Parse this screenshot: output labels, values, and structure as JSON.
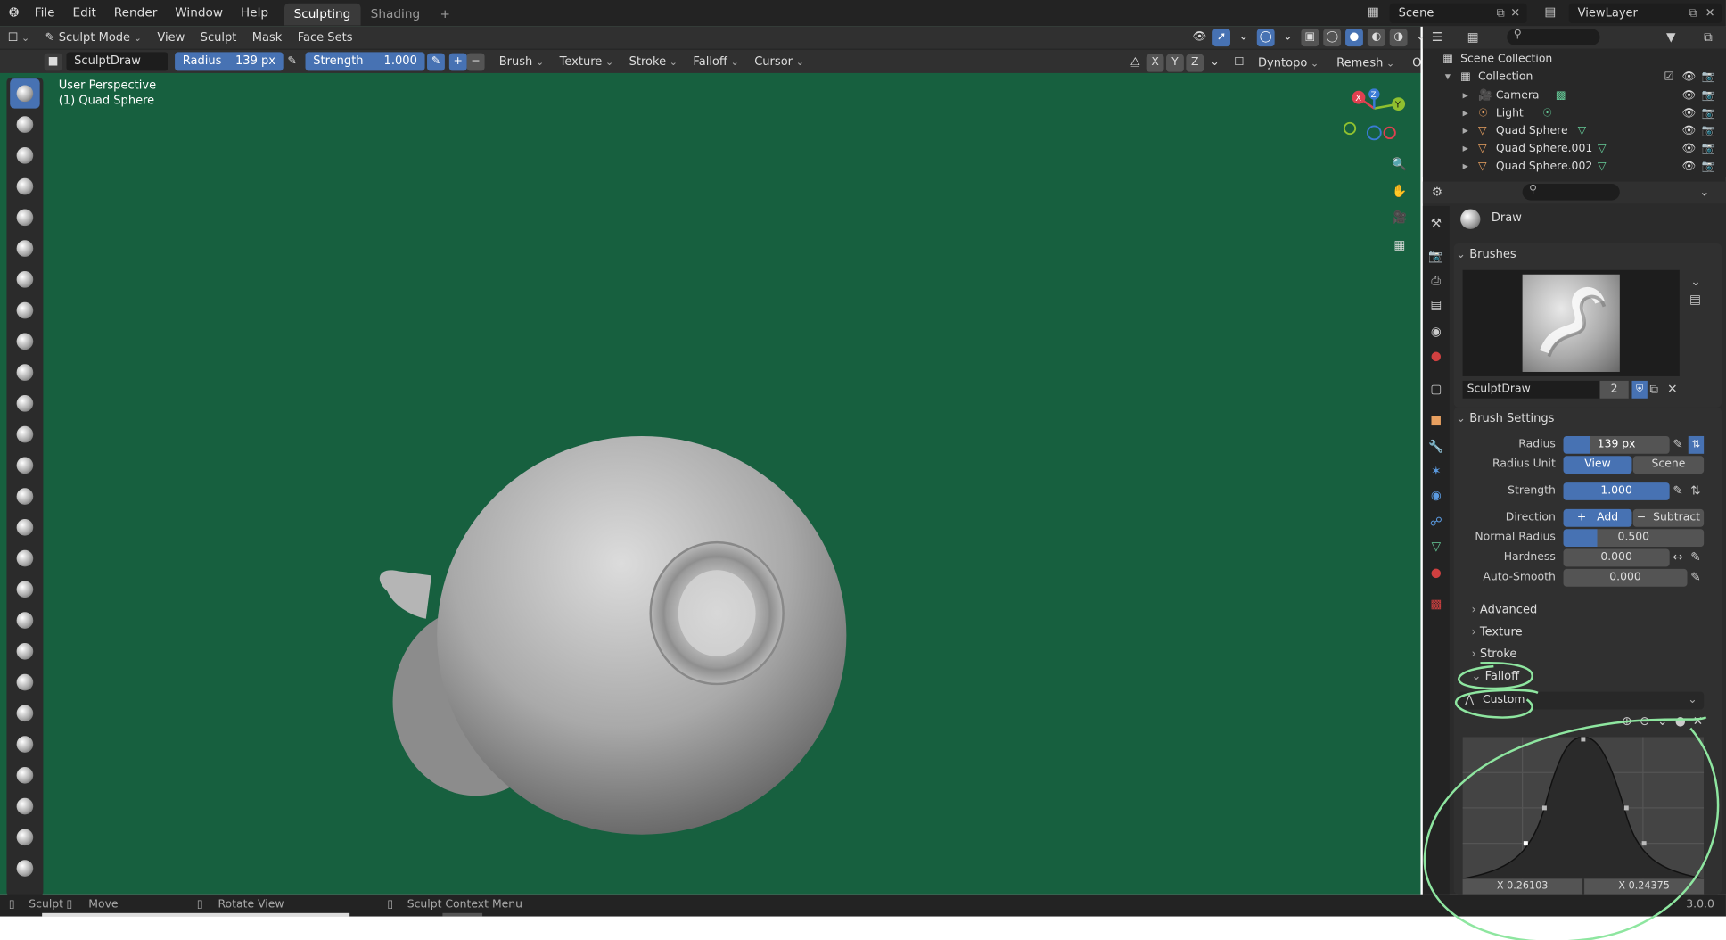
{
  "menu": {
    "items": [
      "File",
      "Edit",
      "Render",
      "Window",
      "Help"
    ],
    "workspaces": [
      "Sculpting",
      "Shading",
      "+"
    ],
    "scene": "Scene",
    "view_layer": "ViewLayer"
  },
  "viewport_header": {
    "mode": "Sculpt Mode",
    "menus": [
      "View",
      "Sculpt",
      "Mask",
      "Face Sets"
    ]
  },
  "tool_header": {
    "brush_name": "SculptDraw",
    "radius_label": "Radius",
    "radius_value": "139 px",
    "strength_label": "Strength",
    "strength_value": "1.000",
    "dropdowns": [
      "Brush",
      "Texture",
      "Stroke",
      "Falloff",
      "Cursor"
    ],
    "axes": [
      "X",
      "Y",
      "Z"
    ],
    "dyntopo": "Dyntopo",
    "remesh": "Remesh",
    "options": "Options"
  },
  "viewport": {
    "perspective": "User Perspective",
    "object": "(1) Quad Sphere",
    "bg_color": "#17603f"
  },
  "gizmo": {
    "x": "X",
    "y": "Y",
    "z": "Z"
  },
  "outliner": {
    "root": "Scene Collection",
    "collection": "Collection",
    "items": [
      "Camera",
      "Light",
      "Quad Sphere",
      "Quad Sphere.001",
      "Quad Sphere.002"
    ]
  },
  "properties": {
    "tool_name": "Draw",
    "brushes_panel": "Brushes",
    "brush_datablock": "SculptDraw",
    "brush_users": "2",
    "brush_settings_panel": "Brush Settings",
    "radius": {
      "label": "Radius",
      "value": "139 px"
    },
    "radius_unit": {
      "label": "Radius Unit",
      "options": [
        "View",
        "Scene"
      ],
      "selected": "View"
    },
    "strength": {
      "label": "Strength",
      "value": "1.000"
    },
    "direction": {
      "label": "Direction",
      "options": [
        "Add",
        "Subtract"
      ],
      "selected": "Add"
    },
    "normal_radius": {
      "label": "Normal Radius",
      "value": "0.500",
      "fraction": 0.5
    },
    "hardness": {
      "label": "Hardness",
      "value": "0.000"
    },
    "auto_smooth": {
      "label": "Auto-Smooth",
      "value": "0.000"
    },
    "subpanels": [
      "Advanced",
      "Texture",
      "Stroke"
    ],
    "falloff_panel": "Falloff",
    "falloff_preset": "Custom",
    "curve_x_left": "X 0.26103",
    "curve_x_right": "X 0.24375"
  },
  "status": {
    "sculpt": "Sculpt",
    "move": "Move",
    "rotate": "Rotate View",
    "context": "Sculpt Context Menu",
    "version": "3.0.0"
  },
  "annotation_color": "#8ee6a0"
}
